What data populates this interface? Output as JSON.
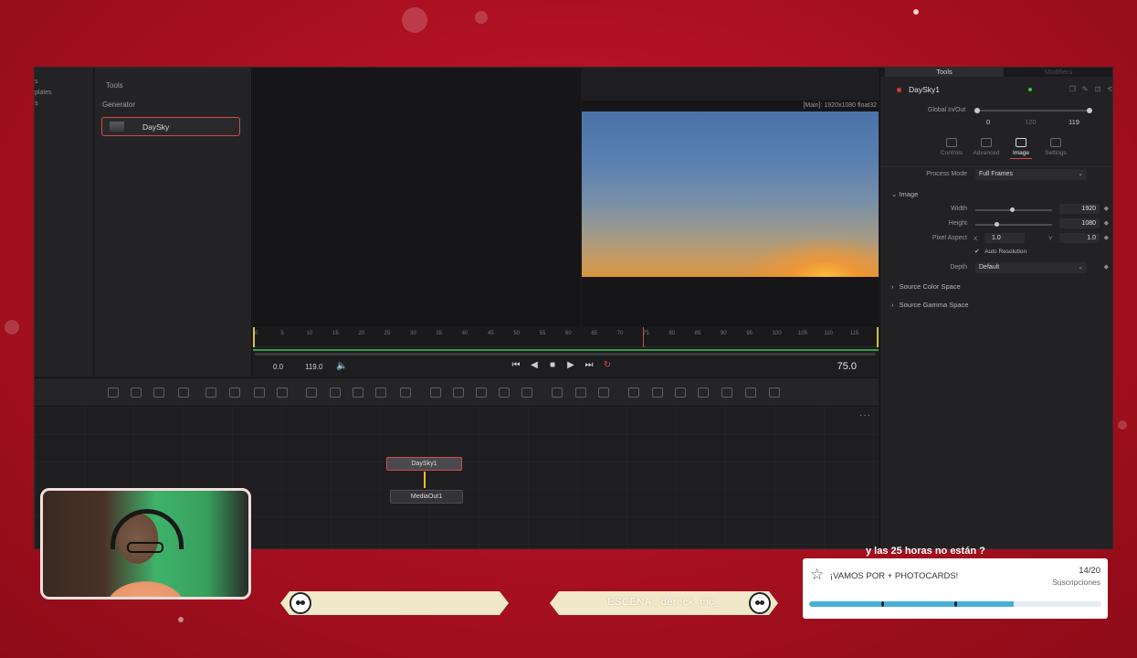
{
  "sidebar": {
    "tree_items": [
      "s",
      "plates",
      "s"
    ]
  },
  "tools_panel": {
    "title": "Tools",
    "category": "Generator",
    "item_label": "DaySky"
  },
  "viewer": {
    "info": "[Main]: 1920x1080 float32"
  },
  "timeline": {
    "ticks": [
      "0",
      "5",
      "10",
      "15",
      "20",
      "25",
      "30",
      "35",
      "40",
      "45",
      "50",
      "55",
      "60",
      "65",
      "70",
      "75",
      "80",
      "85",
      "90",
      "95",
      "100",
      "105",
      "110",
      "115"
    ],
    "playhead_frame": 75
  },
  "transport": {
    "start": "0.0",
    "end": "119.0",
    "audio_icon": "speaker-icon",
    "current": "75.0",
    "controls": [
      "skip-to-start-icon",
      "step-back-icon",
      "stop-icon",
      "play-icon",
      "skip-to-end-icon",
      "loop-icon"
    ],
    "glyphs": {
      "start": "⏮",
      "back": "◀",
      "stop": "■",
      "play": "▶",
      "end": "⏭",
      "loop": "↻",
      "audio": "🔈"
    }
  },
  "node_editor": {
    "nodes": [
      "DaySky1",
      "MediaOut1"
    ],
    "more_glyph": "···"
  },
  "inspector": {
    "tab_tools": "Tools",
    "tab_modifiers": "Modifiers",
    "node_name": "DaySky1",
    "global_inout_label": "Global In/Out",
    "global_in": "0",
    "global_mid": "120",
    "global_out": "119",
    "subtabs": [
      "Controls",
      "Advanced",
      "Image",
      "Settings"
    ],
    "active_subtab": "Image",
    "process_mode_label": "Process Mode",
    "process_mode_value": "Full Frames",
    "image_section": "Image",
    "width_label": "Width",
    "width_value": "1920",
    "height_label": "Height",
    "height_value": "1080",
    "pixel_aspect_label": "Pixel Aspect",
    "pixel_aspect_x_label": "X",
    "pixel_aspect_x": "1.0",
    "pixel_aspect_y_label": "Y",
    "pixel_aspect_y": "1.0",
    "auto_resolution_label": "Auto Resolution",
    "auto_resolution_checked": true,
    "depth_label": "Depth",
    "depth_value": "Default",
    "source_color_space": "Source Color Space",
    "source_gamma_space": "Source Gamma Space",
    "glyphs": {
      "chevron_down": "⌄",
      "chevron_right": "›",
      "check": "✔",
      "diamond": "◆"
    }
  },
  "overlay": {
    "banner_left_text": "",
    "banner_right_text": "ESCENA : dereck_mc_",
    "goal_top_text_faded": "",
    "goal_top_text": "y las 25 horas no están ?",
    "goal_title": "¡VAMOS POR + PHOTOCARDS!",
    "goal_count": "14/20",
    "goal_unit": "Suscripciones",
    "goal_progress": 0.7,
    "goal_star_glyph": "☆",
    "colors": {
      "accent_red": "#d44a4a",
      "progress_blue": "#45b0d8",
      "background_red": "#b8141f"
    }
  }
}
